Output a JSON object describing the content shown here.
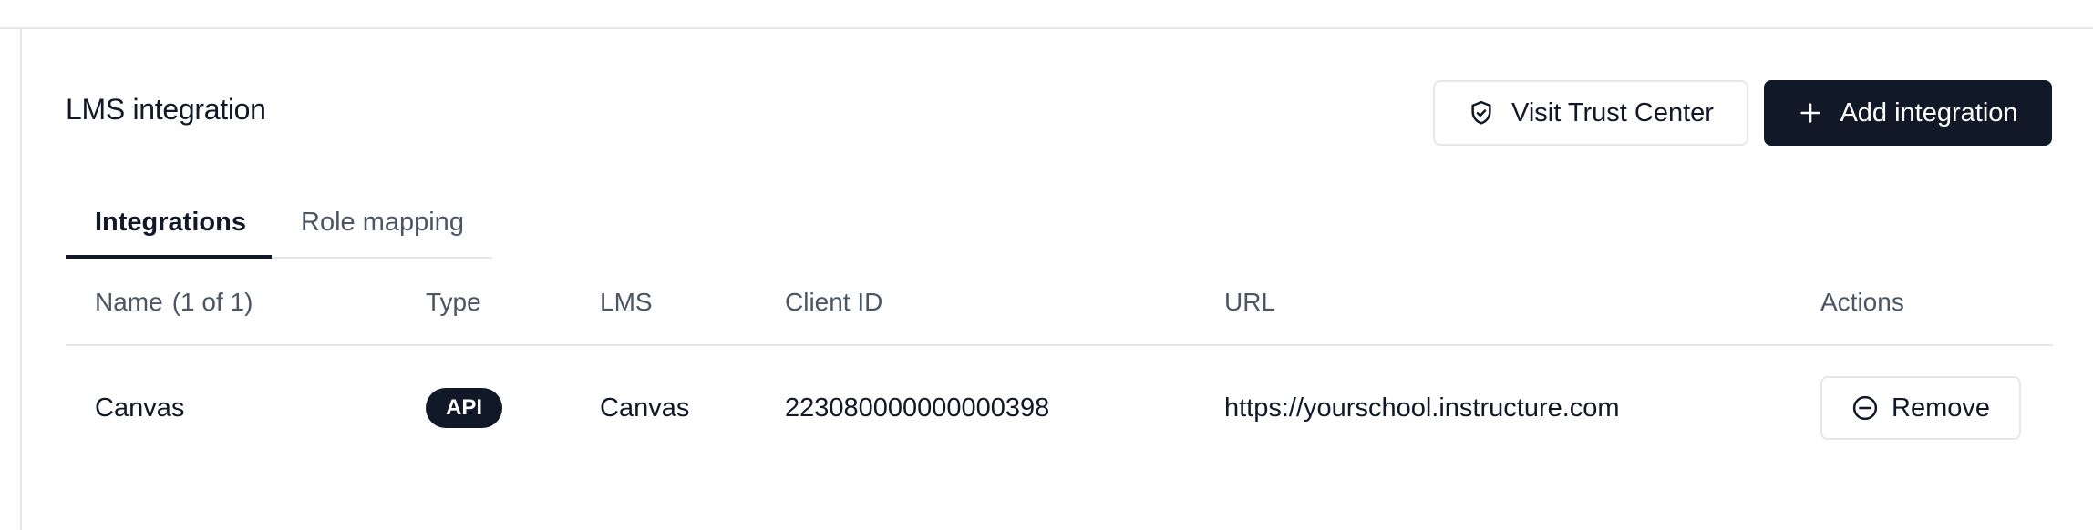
{
  "page": {
    "title": "LMS integration"
  },
  "header_actions": {
    "trust_center_label": "Visit Trust Center",
    "trust_center_icon": "shield-check-icon",
    "add_integration_label": "Add integration",
    "add_integration_icon": "plus-icon"
  },
  "tabs": [
    {
      "label": "Integrations",
      "active": true
    },
    {
      "label": "Role mapping",
      "active": false
    }
  ],
  "table": {
    "columns": {
      "name": "Name",
      "name_count": "(1 of 1)",
      "type": "Type",
      "lms": "LMS",
      "client_id": "Client ID",
      "url": "URL",
      "actions": "Actions"
    },
    "rows": [
      {
        "name": "Canvas",
        "type": "API",
        "lms": "Canvas",
        "client_id": "223080000000000398",
        "url": "https://yourschool.instructure.com",
        "action_label": "Remove",
        "action_icon": "minus-circle-icon"
      }
    ]
  },
  "colors": {
    "primary": "#111827",
    "border": "#e5e7eb",
    "muted_text": "#4b5563"
  }
}
